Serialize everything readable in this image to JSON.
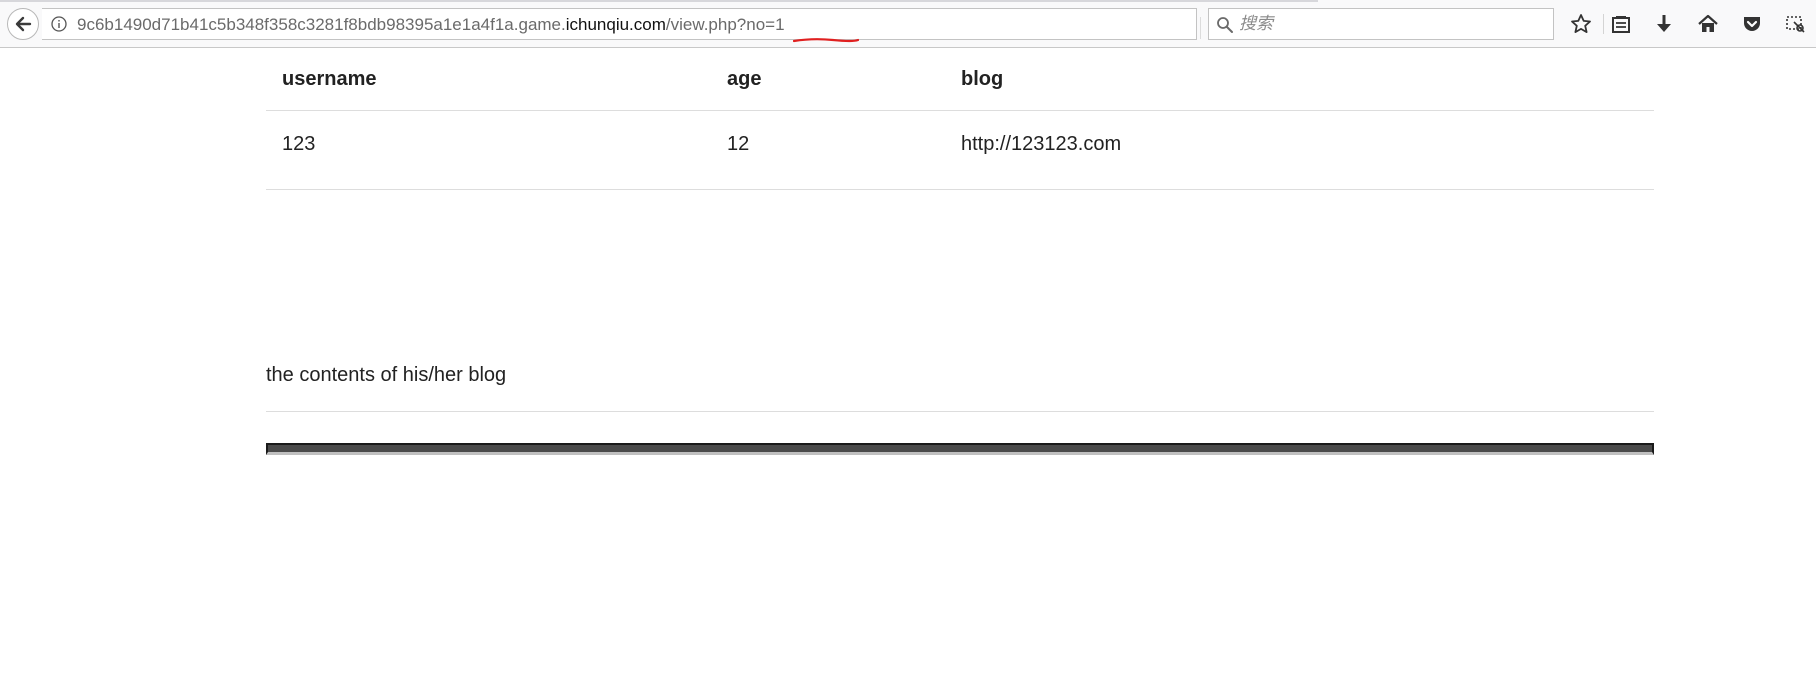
{
  "browser": {
    "url": {
      "prefix": "9c6b1490d71b41c5b348f358c3281f8bdb98395a1e1a4f1a.game.",
      "domain": "ichunqiu.com",
      "path": "/view.php?no=1"
    },
    "search": {
      "placeholder": "搜索"
    },
    "icons": [
      "back-arrow-icon",
      "info-icon",
      "reload-icon",
      "search-icon",
      "star-icon",
      "reading-list-icon",
      "download-icon",
      "home-icon",
      "pocket-icon",
      "screenshot-icon"
    ],
    "annotation_color": "#e02020"
  },
  "table": {
    "headers": [
      "username",
      "age",
      "blog"
    ],
    "rows": [
      [
        "123",
        "12",
        "http://123123.com"
      ]
    ]
  },
  "blog": {
    "heading": "the contents of his/her blog"
  }
}
